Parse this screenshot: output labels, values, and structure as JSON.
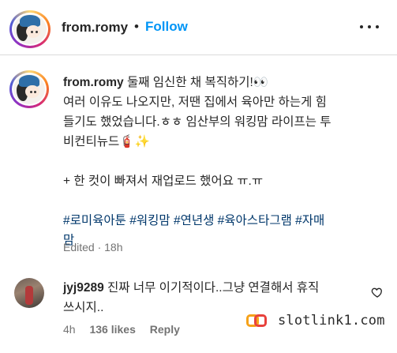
{
  "header": {
    "username": "from.romy",
    "separator": "•",
    "follow_label": "Follow",
    "more_icon": "more-horizontal-icon"
  },
  "caption": {
    "username": "from.romy",
    "line1": "둘째 임신한 채 복직하기!👀",
    "line2": "여러 이유도 나오지만, 저땐 집에서 육아만 하는게 힘",
    "line3": "들기도 했었습니다.ㅎㅎ 임산부의 워킹맘 라이프는 투",
    "line4": "비컨티뉴드🧯✨",
    "line5": "+ 한 컷이 빠져서 재업로드 했어요 ㅠ.ㅠ",
    "hashtags": [
      "#로미육아툰",
      "#워킹맘",
      "#연년생",
      "#육아스타그램",
      "#자매",
      "맘"
    ],
    "edited": "Edited · 18h"
  },
  "comment": {
    "username": "jyj9289",
    "text1": "진짜 너무 이기적이다..그냥 연결해서 휴직",
    "text2": "쓰시지..",
    "time": "4h",
    "likes": "136 likes",
    "reply_label": "Reply",
    "like_icon": "heart-outline-icon"
  },
  "watermark": {
    "text": "slotlink1.com"
  },
  "colors": {
    "link_blue": "#0095f6",
    "hashtag": "#00376b",
    "muted": "#737373",
    "text": "#262626"
  }
}
